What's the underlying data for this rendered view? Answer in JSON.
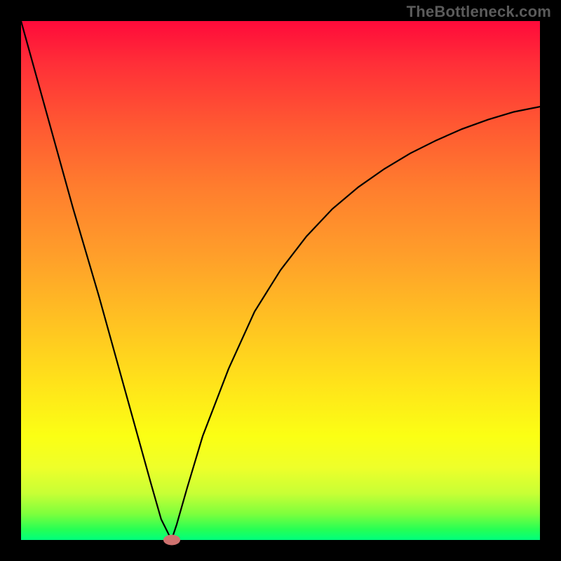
{
  "watermark": "TheBottleneck.com",
  "chart_data": {
    "type": "line",
    "title": "",
    "xlabel": "",
    "ylabel": "",
    "xlim": [
      0,
      100
    ],
    "ylim": [
      0,
      100
    ],
    "grid": false,
    "legend": false,
    "note": "Gradient background red→green (top→bottom). Curve is a V/funnel shape touching zero near x≈29 (marker). Left branch is near-linear; right branch rises with decreasing slope.",
    "marker": {
      "x": 29,
      "y": 0,
      "color": "#cf726f"
    },
    "series": [
      {
        "name": "left-branch",
        "x": [
          0,
          5,
          10,
          15,
          20,
          25,
          27,
          28.5,
          29
        ],
        "values": [
          100,
          82,
          64,
          47,
          29,
          11,
          4,
          1,
          0
        ]
      },
      {
        "name": "right-branch",
        "x": [
          29,
          30,
          32,
          35,
          40,
          45,
          50,
          55,
          60,
          65,
          70,
          75,
          80,
          85,
          90,
          95,
          100
        ],
        "values": [
          0,
          3,
          10,
          20,
          33,
          44,
          52,
          58.5,
          63.8,
          68,
          71.5,
          74.5,
          77,
          79.2,
          81,
          82.5,
          83.5
        ]
      }
    ]
  }
}
